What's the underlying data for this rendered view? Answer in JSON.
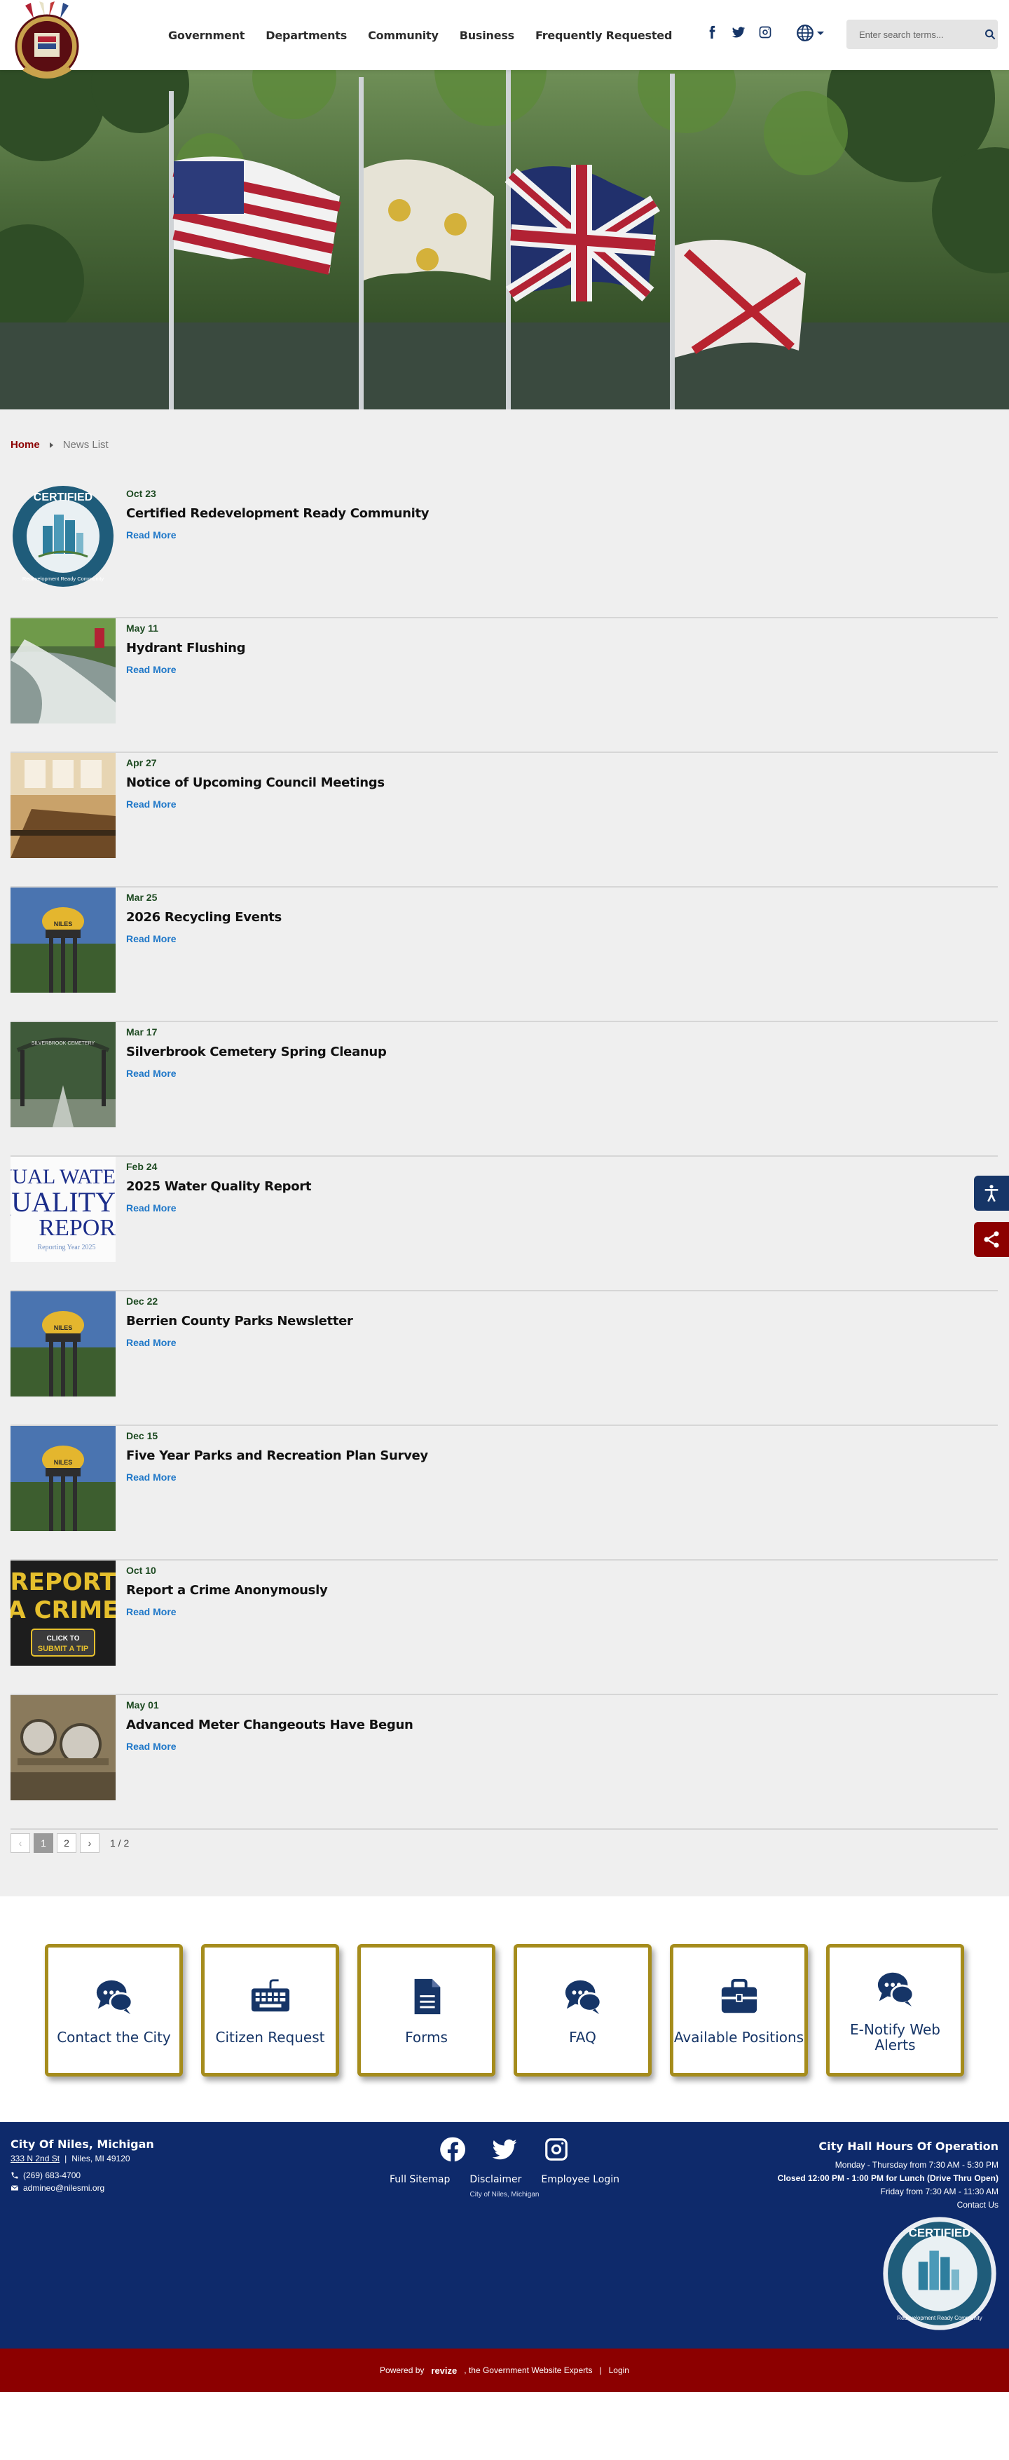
{
  "header": {
    "logo_alt": "City of Niles seal",
    "nav": [
      "Government",
      "Departments",
      "Community",
      "Business",
      "Frequently Requested"
    ],
    "social": [
      "facebook-icon",
      "twitter-icon",
      "instagram-icon"
    ],
    "translate_icon": "globe-icon",
    "search_placeholder": "Enter search terms...",
    "search_icon": "search-icon"
  },
  "breadcrumb": {
    "home": "Home",
    "current": "News List"
  },
  "news": [
    {
      "date": "Oct 23",
      "title": "Certified Redevelopment Ready Community",
      "more": "Read More"
    },
    {
      "date": "May 11",
      "title": "Hydrant Flushing",
      "more": "Read More"
    },
    {
      "date": "Apr 27",
      "title": "Notice of Upcoming Council Meetings",
      "more": "Read More"
    },
    {
      "date": "Mar 25",
      "title": "2026 Recycling Events",
      "more": "Read More"
    },
    {
      "date": "Mar 17",
      "title": "Silverbrook Cemetery Spring Cleanup",
      "more": "Read More"
    },
    {
      "date": "Feb 24",
      "title": "2025 Water Quality Report",
      "more": "Read More"
    },
    {
      "date": "Dec 22",
      "title": "Berrien County Parks Newsletter",
      "more": "Read More"
    },
    {
      "date": "Dec 15",
      "title": "Five Year Parks and Recreation Plan Survey",
      "more": "Read More"
    },
    {
      "date": "Oct 10",
      "title": "Report a Crime Anonymously",
      "more": "Read More"
    },
    {
      "date": "May 01",
      "title": "Advanced Meter Changeouts Have Begun",
      "more": "Read More"
    }
  ],
  "thumb_text": {
    "certified_top": "CERTIFIED",
    "certified_bottom": "Redevelopment Ready Community",
    "water1": "NUAL WATE",
    "water2": "QUALITY",
    "water3": "REPOR",
    "water4": "Reporting Year 2025",
    "tower": "NILES",
    "cemetery": "SILVERBROOK CEMETERY",
    "report1": "REPORT",
    "report2": "A CRIME",
    "report3": "CLICK TO",
    "report4": "SUBMIT A TIP"
  },
  "pagination": {
    "prev": "‹",
    "pages": [
      "1",
      "2"
    ],
    "next": "›",
    "count": "1 / 2"
  },
  "quick_links": [
    {
      "label": "Contact the City",
      "icon": "chat-bubbles-icon"
    },
    {
      "label": "Citizen Request",
      "icon": "keyboard-icon"
    },
    {
      "label": "Forms",
      "icon": "document-icon"
    },
    {
      "label": "FAQ",
      "icon": "chat-bubbles-icon"
    },
    {
      "label": "Available Positions",
      "icon": "briefcase-icon"
    },
    {
      "label": "E-Notify Web Alerts",
      "icon": "chat-bubbles-icon"
    }
  ],
  "footer": {
    "name": "City Of Niles, Michigan",
    "address_street": "333 N 2nd St",
    "address_city": "Niles, MI 49120",
    "phone": "(269) 683-4700",
    "email": "admineo@nilesmi.org",
    "links": [
      "Full Sitemap",
      "Disclaimer",
      "Employee Login"
    ],
    "copyright": "City of Niles, Michigan",
    "hours_title": "City Hall Hours Of Operation",
    "hours": [
      "Monday - Thursday from 7:30 AM - 5:30 PM",
      "Closed 12:00 PM - 1:00 PM for Lunch (Drive Thru Open)",
      "Friday from 7:30 AM - 11:30 AM",
      "Contact Us"
    ]
  },
  "bottombar": {
    "powered": "Powered by",
    "brand": "revize",
    "tagline": ", the Government Website Experts",
    "login": "Login"
  },
  "colors": {
    "navy": "#163567",
    "maroon": "#8c0000",
    "gold": "#a58c1c",
    "date_green": "#1d4a21",
    "link_blue": "#1e77c8"
  }
}
